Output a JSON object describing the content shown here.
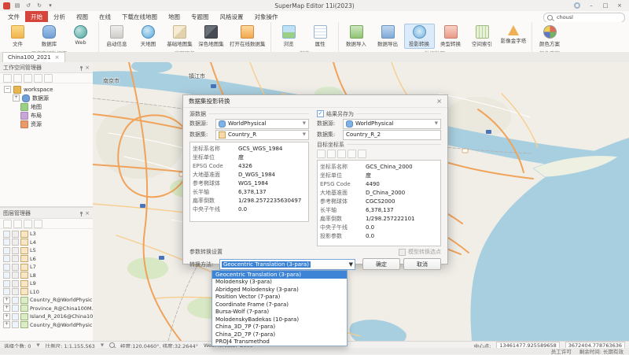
{
  "app": {
    "title": "SuperMap Editor 11i(2023)"
  },
  "tabs": {
    "items": [
      "文件",
      "开始",
      "分析",
      "视图",
      "在线",
      "下载在线地图",
      "地图",
      "专题图",
      "风格设置",
      "对象操作"
    ]
  },
  "search": {
    "value": "chousl"
  },
  "ribbon": {
    "groups": [
      {
        "label": "工作空间数据源",
        "buttons": [
          "文件",
          "数据库",
          "Web"
        ]
      },
      {
        "label": "底图服务",
        "buttons": [
          "启动信息",
          "天地图",
          "基础地图集",
          "深色地图集",
          "打开在线数据集"
        ]
      },
      {
        "label": "浏览",
        "buttons": [
          "浏览",
          "属性"
        ]
      },
      {
        "label": "数据处理",
        "buttons": [
          "数据导入",
          "数据导出",
          "投影转换",
          "类型转换",
          "空间索引",
          "影像金字塔"
        ]
      },
      {
        "label": "颜色方案",
        "buttons": [
          "颜色方案"
        ]
      }
    ]
  },
  "doc_tabs": {
    "items": [
      "China100_2021"
    ]
  },
  "workspace_panel": {
    "title": "工作空间管理器",
    "root": "workspace",
    "children": [
      "数据源",
      "地图",
      "布局",
      "资源"
    ]
  },
  "layer_panel": {
    "title": "图层管理器",
    "layers": [
      "L3",
      "L4",
      "L5",
      "L6",
      "L7",
      "L8",
      "L9",
      "L10",
      "Country_R@WorldPhysic...",
      "Province_R@China100M...",
      "Island_R_2016@China10...",
      "Country_R@WorldPhysic..."
    ]
  },
  "map": {
    "labels": [
      {
        "text": "南京市"
      },
      {
        "text": "镇江市"
      }
    ]
  },
  "dialog": {
    "title": "数据集投影转换",
    "source": {
      "section": "源数据",
      "datasource_label": "数据源:",
      "datasource": "WorldPhysical",
      "dataset_label": "数据集:",
      "dataset": "Country_R"
    },
    "result": {
      "section": "结果另存为",
      "datasource_label": "数据源:",
      "datasource": "WorldPhysical",
      "dataset_label": "数据集:",
      "dataset": "Country_R_2"
    },
    "target_section": "目标坐标系",
    "source_info": {
      "rows": [
        [
          "坐标系名称",
          "GCS_WGS_1984"
        ],
        [
          "坐标单位",
          "度"
        ],
        [
          "EPSG Code",
          "4326"
        ],
        [
          "大地基准面",
          "D_WGS_1984"
        ],
        [
          "参考椭球体",
          "WGS_1984"
        ],
        [
          "长半轴",
          "6,378,137"
        ],
        [
          "扁率倒数",
          "1/298.2572235630497"
        ],
        [
          "中央子午线",
          "0.0"
        ]
      ]
    },
    "target_info": {
      "rows": [
        [
          "坐标系名称",
          "GCS_China_2000"
        ],
        [
          "坐标单位",
          "度"
        ],
        [
          "EPSG Code",
          "4490"
        ],
        [
          "大地基准面",
          "D_China_2000"
        ],
        [
          "参考椭球体",
          "CGCS2000"
        ],
        [
          "长半轴",
          "6,378,137"
        ],
        [
          "扁率倒数",
          "1/298.257222101"
        ],
        [
          "中央子午线",
          "0.0"
        ],
        [
          "投影参数",
          "0.0"
        ]
      ]
    },
    "transform": {
      "section": "参数转换设置",
      "method_label": "转换方法:",
      "value": "Geocentric Translation (3-para)",
      "options": [
        "Geocentric Translation (3-para)",
        "Molodensky (3-para)",
        "Abridged Molodensky (3-para)",
        "Position Vector (7-para)",
        "Coordinate Frame (7-para)",
        "Bursa-Wolf (7-para)",
        "MolodenskyBadekas (10-para)",
        "China_3D_7P (7-para)",
        "China_2D_7P (7-para)",
        "PROJ4 Transmethod"
      ]
    },
    "model_point": "模型转换选点",
    "ok": "确定",
    "cancel": "取消"
  },
  "status": {
    "selection": "选择个数: 0",
    "scale": "比例尺: 1:1,155,563",
    "coords": "经度:120.0460°, 纬度:32.2644°",
    "crs": "WebMercator_2000",
    "center_label": "中心点:",
    "center_x": "13461477.925589658",
    "center_y": "3672404.778763636",
    "license": "员工许可",
    "remaining": "剩余时间: 长期有效"
  }
}
